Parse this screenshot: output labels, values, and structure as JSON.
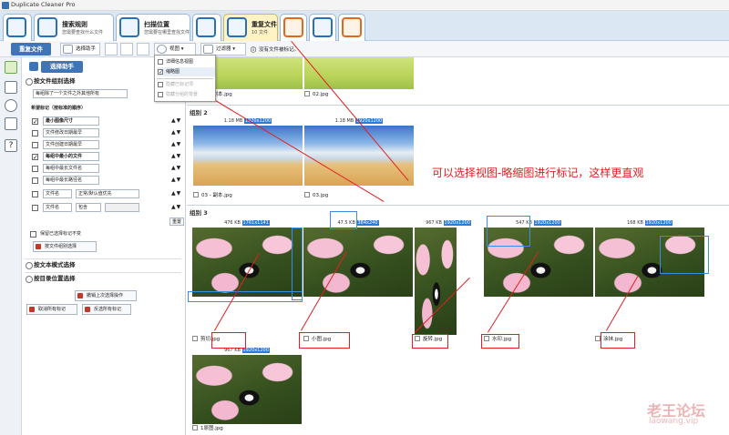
{
  "app": {
    "title": "Duplicate Cleaner Pro"
  },
  "ribbon": {
    "tabs": [
      {
        "title": "搜索规则",
        "subtitle": "您需要查找什么文件"
      },
      {
        "title": "扫描位置",
        "subtitle": "您需要在哪里查找文件"
      },
      {
        "title": "重复文件",
        "subtitle": "10 文件"
      }
    ]
  },
  "toolbar": {
    "dup_files": "重复文件",
    "select_assistant": "选择助手",
    "view": "视图",
    "filter": "过滤器",
    "status": "没有文件被标记。"
  },
  "view_menu": {
    "items": [
      {
        "label": "详细信息视图",
        "checked": false
      },
      {
        "label": "缩略图",
        "checked": true
      },
      {
        "label": "隐藏已标记项",
        "checked": false
      },
      {
        "label": "隐藏分组的背景",
        "checked": false
      }
    ]
  },
  "panel": {
    "header": "选择助手",
    "sec1": "按文件组别选择",
    "sec1_dropdown": "每组除了一个文件之外其他所有",
    "criteria_label": "希望标记（按标准的顺序）",
    "criteria": [
      {
        "checked": true,
        "label": "最小图像尺寸",
        "bold": true
      },
      {
        "checked": false,
        "label": "文件修改日期最早"
      },
      {
        "checked": false,
        "label": "文件创建日期最早"
      },
      {
        "checked": true,
        "label": "每组中最小的文件",
        "bold": true
      },
      {
        "checked": false,
        "label": "每组中最长文件名"
      },
      {
        "checked": false,
        "label": "每组中最长路径名"
      },
      {
        "checked": false,
        "label": "文件名",
        "second": "正常/默认值优先"
      },
      {
        "checked": false,
        "label": "文件名",
        "second": "包含"
      }
    ],
    "reset": "重置",
    "keep_checked": "保留已选择标记不变",
    "apply_group": "按文件组别选择",
    "sec2": "按文本模式选择",
    "sec3": "按目录位置选择",
    "undo": "撤销上次选择操作",
    "clear_all": "取消所有标记",
    "invert": "反选所有标记"
  },
  "groups": [
    {
      "label": "",
      "items": [
        {
          "name": "01 - 副本.jpg"
        },
        {
          "name": "02.jpg"
        }
      ]
    },
    {
      "label": "组别 2",
      "items": [
        {
          "size": "1.18 MB",
          "dims": "1920x1200",
          "name": "03 - 副本.jpg"
        },
        {
          "size": "1.18 MB",
          "dims": "1920x1200",
          "name": "03.jpg"
        }
      ]
    },
    {
      "label": "组别 3",
      "items": [
        {
          "size": "476 KB",
          "dims": "1761x1141",
          "name": "剪切.jpg"
        },
        {
          "size": "47.5 KB",
          "dims": "384x240",
          "name": "小图.jpg"
        },
        {
          "size": "967 KB",
          "dims": "1920x1200",
          "name": "旋转.jpg"
        },
        {
          "size": "547 KB",
          "dims": "1920x1200",
          "name": "水印.jpg"
        },
        {
          "size": "168 KB",
          "dims": "1920x1200",
          "name": "涂抹.jpg"
        },
        {
          "size": "967 KB",
          "dims": "1920x1200",
          "name": "1原图.jpg"
        }
      ]
    }
  ],
  "annotation": "可以选择视图-略缩图进行标记，这样更直观",
  "watermark": {
    "text": "老王论坛",
    "url": "laowang.vip"
  },
  "colors": {
    "accent": "#3d75b8",
    "annotation": "#e02020",
    "selection": "#3a8ee0"
  }
}
